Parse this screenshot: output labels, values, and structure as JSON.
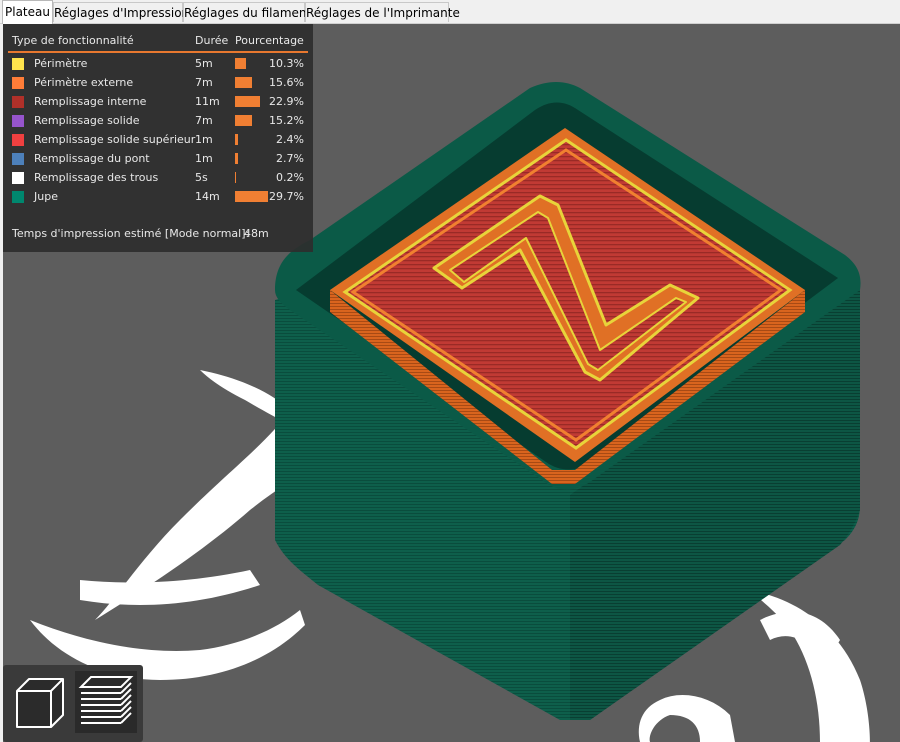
{
  "tabs": [
    {
      "label": "Plateau",
      "active": true
    },
    {
      "label": "Réglages d'Impression",
      "active": false
    },
    {
      "label": "Réglages du filament",
      "active": false
    },
    {
      "label": "Réglages de l'Imprimante",
      "active": false
    }
  ],
  "legend": {
    "headers": {
      "type": "Type de fonctionnalité",
      "duration": "Durée",
      "percent": "Pourcentage"
    },
    "rows": [
      {
        "name": "Périmètre",
        "duration": "5m",
        "percent": "10.3%",
        "fraction": 0.103,
        "color": "#ffe44d"
      },
      {
        "name": "Périmètre externe",
        "duration": "7m",
        "percent": "15.6%",
        "fraction": 0.156,
        "color": "#ff7d38"
      },
      {
        "name": "Remplissage interne",
        "duration": "11m",
        "percent": "22.9%",
        "fraction": 0.229,
        "color": "#b03029"
      },
      {
        "name": "Remplissage solide",
        "duration": "7m",
        "percent": "15.2%",
        "fraction": 0.152,
        "color": "#9654cc"
      },
      {
        "name": "Remplissage solide supérieur",
        "duration": "1m",
        "percent": "2.4%",
        "fraction": 0.024,
        "color": "#f04040"
      },
      {
        "name": "Remplissage du pont",
        "duration": "1m",
        "percent": "2.7%",
        "fraction": 0.027,
        "color": "#4d80ba"
      },
      {
        "name": "Remplissage des trous",
        "duration": "5s",
        "percent": "0.2%",
        "fraction": 0.002,
        "color": "#ffffff"
      },
      {
        "name": "Jupe",
        "duration": "14m",
        "percent": "29.7%",
        "fraction": 0.297,
        "color": "#00876e"
      }
    ],
    "estimate_label": "Temps d'impression estimé [Mode normal]:",
    "estimate_value": "48m"
  },
  "model": {
    "top_letter": "Z"
  },
  "view_buttons": [
    {
      "icon": "cube-3d-view-icon",
      "selected": false
    },
    {
      "icon": "layers-preview-icon",
      "selected": true
    }
  ],
  "colors": {
    "viewport_bg": "#5d5d5d",
    "accent": "#e8782f"
  }
}
